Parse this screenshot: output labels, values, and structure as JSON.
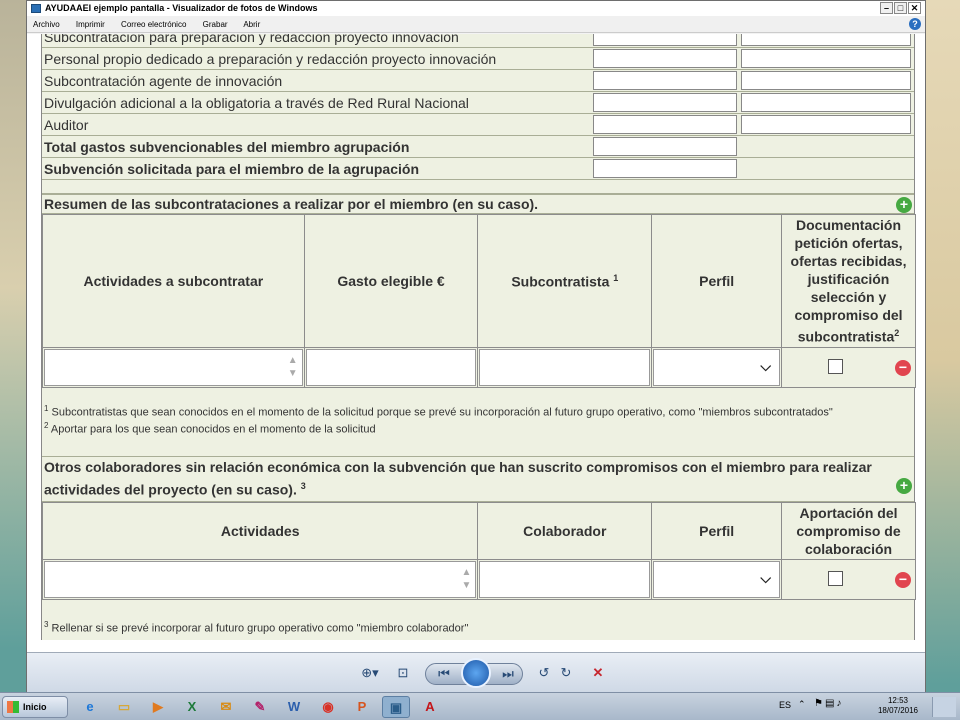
{
  "window": {
    "title": "AYUDAAEI ejemplo pantalla - Visualizador de fotos de Windows",
    "menu": [
      "Archivo",
      "Imprimir",
      "Correo electrónico",
      "Grabar",
      "Abrir"
    ],
    "help_label": "?"
  },
  "budget_rows": [
    {
      "label": "Subcontratación para preparación y redacción proyecto innovación",
      "bold": false,
      "boxes": 2
    },
    {
      "label": "Personal propio dedicado a preparación y redacción proyecto innovación",
      "bold": false,
      "boxes": 2
    },
    {
      "label": "Subcontratación agente de innovación",
      "bold": false,
      "boxes": 2
    },
    {
      "label": "Divulgación adicional a la obligatoria a través de Red Rural Nacional",
      "bold": false,
      "boxes": 2
    },
    {
      "label": "Auditor",
      "bold": false,
      "boxes": 2
    },
    {
      "label": "Total gastos subvencionables del miembro agrupación",
      "bold": true,
      "boxes": 1
    },
    {
      "label": "Subvención solicitada para el miembro de la agrupación",
      "bold": true,
      "boxes": 1
    }
  ],
  "subcontracting": {
    "title": "Resumen de las subcontrataciones a realizar por el miembro (en su caso).",
    "headers": {
      "activities": "Actividades a subcontratar",
      "eligible_cost": "Gasto elegible €",
      "subcontractor": "Subcontratista",
      "subcontractor_sup": "1",
      "profile": "Perfil",
      "documentation": "Documentación petición ofertas, ofertas recibidas, justificación selección y compromiso del subcontratista",
      "documentation_sup": "2"
    },
    "notes": [
      {
        "sup": "1",
        "text": "Subcontratistas que sean conocidos en el momento de la solicitud porque se prevé su incorporación al futuro grupo operativo, como \"miembros subcontratados\""
      },
      {
        "sup": "2",
        "text": "Aportar para los que sean conocidos en el momento de la solicitud"
      }
    ]
  },
  "collaborators": {
    "title": "Otros colaboradores sin relación económica con la subvención que han suscrito compromisos con el miembro para realizar actividades del proyecto (en su caso).",
    "title_sup": "3",
    "headers": {
      "activities": "Actividades",
      "collaborator": "Colaborador",
      "profile": "Perfil",
      "contribution": "Aportación del compromiso de colaboración"
    },
    "notes": [
      {
        "sup": "3",
        "text": "Rellenar si se prevé incorporar al futuro grupo operativo como \"miembro colaborador\""
      }
    ]
  },
  "taskbar": {
    "start_label": "Inicio",
    "language": "ES",
    "time": "12:53",
    "date": "18/07/2016"
  }
}
